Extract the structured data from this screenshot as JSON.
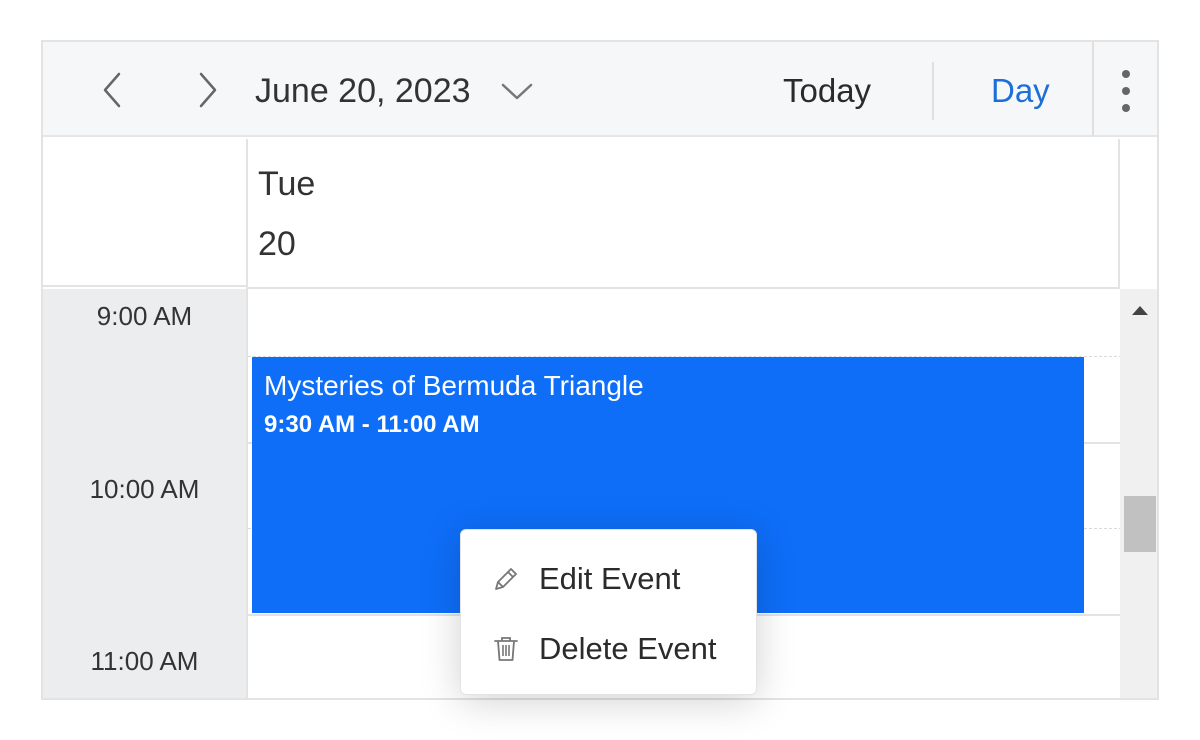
{
  "toolbar": {
    "date_caption": "June 20, 2023",
    "today_label": "Today",
    "view_label": "Day",
    "accent_color": "#1c6fd8",
    "icons": {
      "prev": "chevron-left-icon",
      "next": "chevron-right-icon",
      "caption_dropdown": "chevron-down-icon",
      "more": "more-vertical-icon"
    }
  },
  "header": {
    "day_name": "Tue",
    "day_number": "20"
  },
  "time_scale": {
    "labels": [
      "9:00 AM",
      "10:00 AM",
      "11:00 AM"
    ]
  },
  "appointment": {
    "title": "Mysteries of Bermuda Triangle",
    "time_range": "9:30 AM - 11:00 AM",
    "color": "#0e6ef8"
  },
  "context_menu": {
    "items": [
      {
        "label": "Edit Event",
        "icon": "pencil-icon"
      },
      {
        "label": "Delete Event",
        "icon": "trash-icon"
      }
    ]
  }
}
